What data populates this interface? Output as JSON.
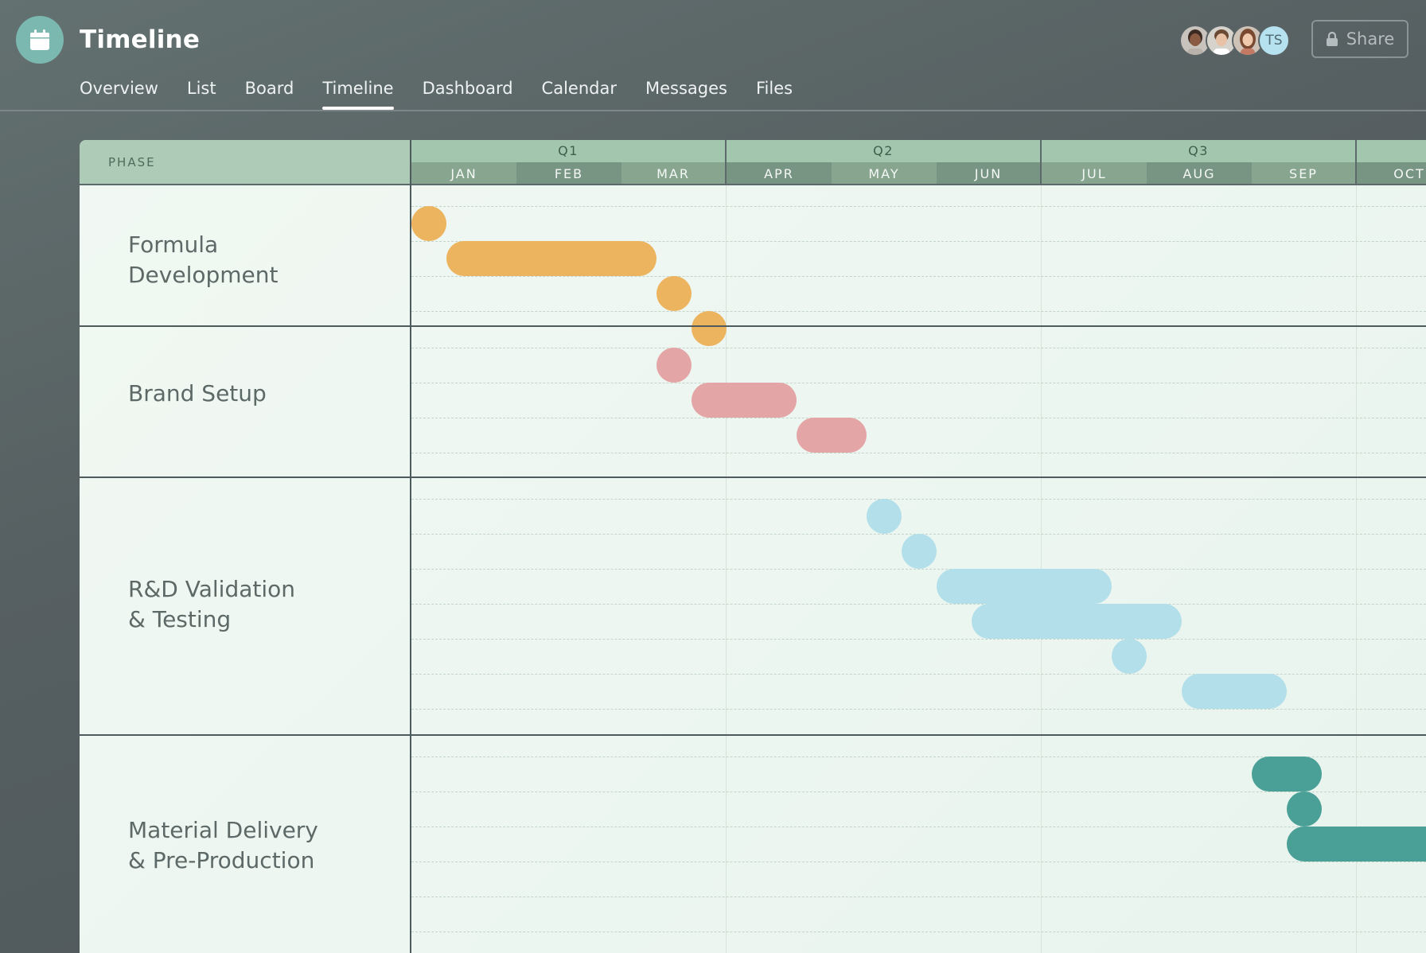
{
  "header": {
    "title": "Timeline",
    "app_icon": "calendar-icon",
    "share_label": "Share",
    "share_icon": "lock-icon"
  },
  "avatars": [
    {
      "name": "avatar-1",
      "type": "photo"
    },
    {
      "name": "avatar-2",
      "type": "photo"
    },
    {
      "name": "avatar-3",
      "type": "photo"
    },
    {
      "name": "avatar-4",
      "type": "initials",
      "initials": "TS"
    }
  ],
  "tabs": [
    {
      "label": "Overview",
      "active": false
    },
    {
      "label": "List",
      "active": false
    },
    {
      "label": "Board",
      "active": false
    },
    {
      "label": "Timeline",
      "active": true
    },
    {
      "label": "Dashboard",
      "active": false
    },
    {
      "label": "Calendar",
      "active": false
    },
    {
      "label": "Messages",
      "active": false
    },
    {
      "label": "Files",
      "active": false
    }
  ],
  "timeline": {
    "phase_header": "PHASE",
    "quarters": [
      "Q1",
      "Q2",
      "Q3"
    ],
    "months": [
      "JAN",
      "FEB",
      "MAR",
      "APR",
      "MAY",
      "JUN",
      "JUL",
      "AUG",
      "SEP",
      "OCT"
    ],
    "colors": {
      "formula": "#ecb45f",
      "brand": "#e4a5a6",
      "rnd": "#b2dfea",
      "material": "#4aa096"
    },
    "phases": [
      {
        "label_lines": [
          "Formula",
          "Development"
        ],
        "color": "orange",
        "tasks": [
          {
            "start_month": 0.0,
            "end_month": 0.33
          },
          {
            "start_month": 0.33,
            "end_month": 2.33
          },
          {
            "start_month": 2.33,
            "end_month": 2.67
          },
          {
            "start_month": 2.67,
            "end_month": 3.0
          }
        ]
      },
      {
        "label_lines": [
          "Brand Setup"
        ],
        "color": "pink",
        "tasks": [
          {
            "start_month": 2.33,
            "end_month": 2.67
          },
          {
            "start_month": 2.67,
            "end_month": 3.67
          },
          {
            "start_month": 3.67,
            "end_month": 4.33
          }
        ]
      },
      {
        "label_lines": [
          "R&D Validation",
          "& Testing"
        ],
        "color": "blue",
        "tasks": [
          {
            "start_month": 4.33,
            "end_month": 4.67
          },
          {
            "start_month": 4.67,
            "end_month": 5.0
          },
          {
            "start_month": 5.0,
            "end_month": 6.67
          },
          {
            "start_month": 5.33,
            "end_month": 7.33
          },
          {
            "start_month": 6.67,
            "end_month": 7.0
          },
          {
            "start_month": 7.33,
            "end_month": 8.33
          }
        ]
      },
      {
        "label_lines": [
          "Material Delivery",
          "& Pre-Production"
        ],
        "color": "teal",
        "tasks": [
          {
            "start_month": 8.0,
            "end_month": 8.67
          },
          {
            "start_month": 8.33,
            "end_month": 8.67
          },
          {
            "start_month": 8.33,
            "end_month": 10.5
          }
        ]
      }
    ]
  }
}
